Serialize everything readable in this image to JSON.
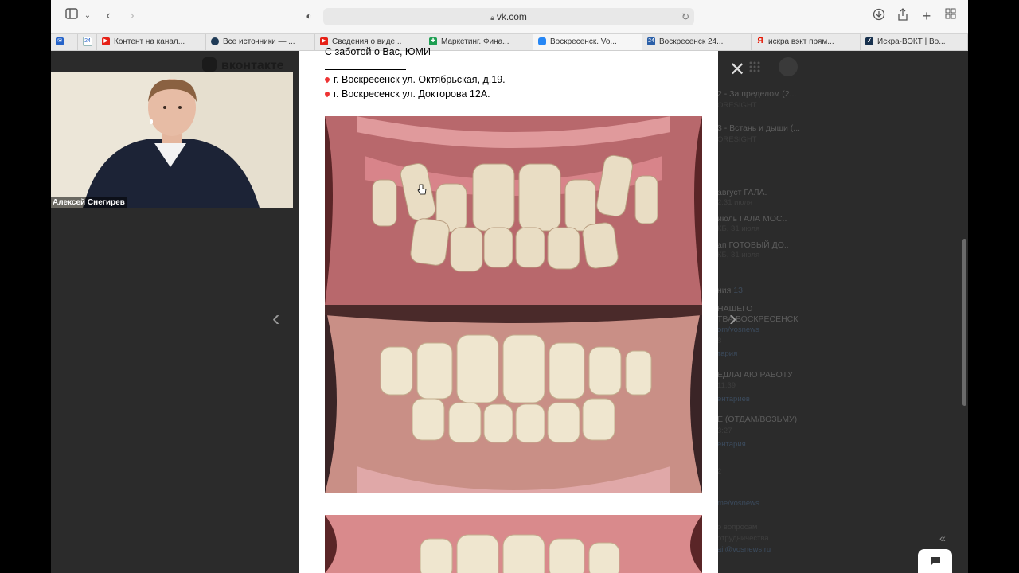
{
  "browser": {
    "url": "vk.com",
    "tabs": [
      {
        "label": "Контент на канал...",
        "favicon": "youtube-icon",
        "color": "#e62117"
      },
      {
        "label": "Все источники — ...",
        "favicon": "dot-icon",
        "color": "#1f3b57"
      },
      {
        "label": "Сведения о виде...",
        "favicon": "youtube-icon",
        "color": "#e62117"
      },
      {
        "label": "Маркетинг. Фина...",
        "favicon": "sheets-icon",
        "color": "#1e9e52"
      },
      {
        "label": "Воскресенск. Vo...",
        "favicon": "vk-icon",
        "color": "#2787f5"
      },
      {
        "label": "Воскресенск 24...",
        "favicon": "24-icon",
        "color": "#2a5fa8"
      },
      {
        "label": "искра вэкт прям...",
        "favicon": "yandex-icon",
        "color": "#e61400"
      },
      {
        "label": "Искра-ВЭКТ | Во...",
        "favicon": "iskra-icon",
        "color": "#17304d"
      }
    ]
  },
  "vk": {
    "logo_text": "вконтакте"
  },
  "webcam": {
    "name": "Алексей Снегирев"
  },
  "post": {
    "signature": "С заботой о Вас, ЮМИ",
    "addresses": [
      "г. Воскресенск ул. Октябрьская, д.19.",
      "г. Воскресенск ул. Докторова 12А."
    ]
  },
  "right_panel": {
    "items": [
      {
        "title": "2 - За пределом (2...",
        "sub": "ORESIGHT"
      },
      {
        "title": "3 - Встань и дыши (...",
        "sub": "ORESIGHT"
      },
      {
        "title": "август ГАЛА.",
        "sub": "2:31 июля"
      },
      {
        "title": "июль ГАЛА МОС..",
        "sub": "КБ, 31 июля"
      },
      {
        "title": "ап ГОТОВЫЙ ДО..",
        "sub": "КБ, 31 июля"
      }
    ],
    "section_label": "ния",
    "section_count": "13",
    "groups": [
      {
        "title": "НАШЕГО",
        "title2": "ТВА ВОСКРЕСЕНСК",
        "link": "om/vosnews",
        "meta": "8",
        "comments": "тария"
      },
      {
        "title": "ЕДЛАГАЮ РАБОТУ",
        "meta": "11:39",
        "comments": "ентариев"
      },
      {
        "title": "Е (ОТДАМ/ВОЗЬМУ)",
        "meta": "3:27",
        "comments": "ентария"
      }
    ],
    "footer_count": "2",
    "footer_link": "me/vosnews",
    "footer_text1": "о вопросам",
    "footer_text2": "отрудничества",
    "footer_email": "ail@vosnews.ru"
  }
}
